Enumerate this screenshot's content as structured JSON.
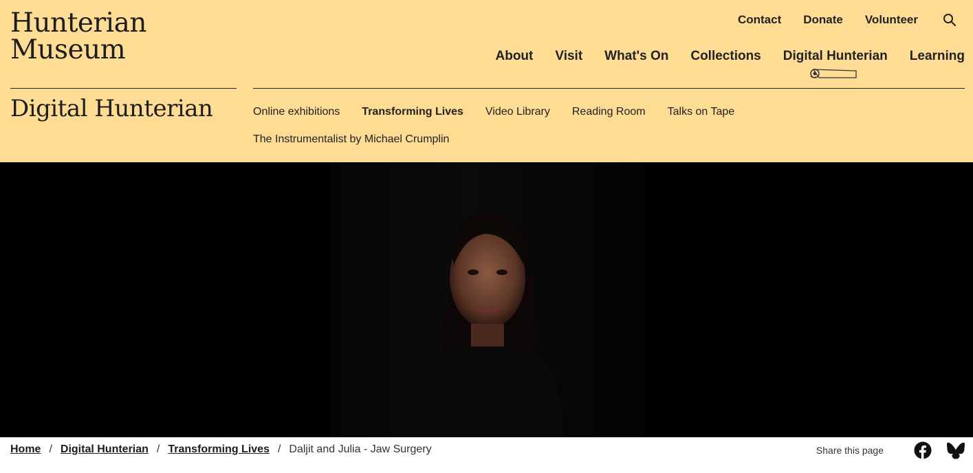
{
  "logo": {
    "line1": "Hunterian",
    "line2": "Museum"
  },
  "utility_nav": {
    "contact": "Contact",
    "donate": "Donate",
    "volunteer": "Volunteer"
  },
  "main_nav": [
    "About",
    "Visit",
    "What's On",
    "Collections",
    "Digital Hunterian",
    "Learning"
  ],
  "section_title": "Digital Hunterian",
  "sub_nav": [
    "Online exhibitions",
    "Transforming Lives",
    "Video Library",
    "Reading Room",
    "Talks on Tape",
    "The Instrumentalist by Michael Crumplin"
  ],
  "breadcrumb": {
    "home": "Home",
    "section": "Digital Hunterian",
    "parent": "Transforming Lives",
    "current": "Daljit and Julia - Jaw Surgery",
    "separator": "/"
  },
  "share": {
    "label": "Share this page"
  },
  "colors": {
    "header_bg": "#fedc94",
    "text": "#1c1c1c",
    "hero_bg": "#000000"
  }
}
